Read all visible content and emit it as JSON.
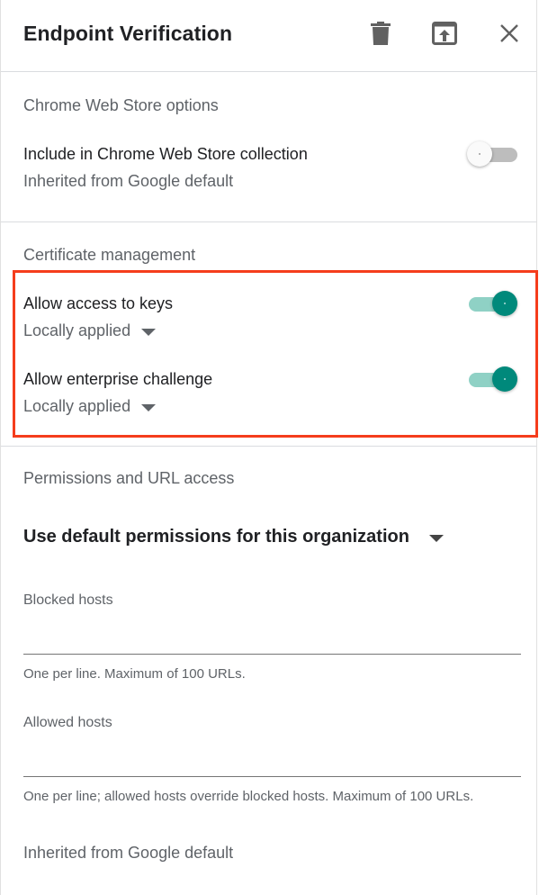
{
  "header": {
    "title": "Endpoint Verification",
    "icons": [
      "delete-icon",
      "open-in-new-icon",
      "close-icon"
    ]
  },
  "chrome_web_store": {
    "section_title": "Chrome Web Store options",
    "include_label": "Include in Chrome Web Store collection",
    "include_sub": "Inherited from Google default",
    "include_enabled": false
  },
  "certificate": {
    "section_title": "Certificate management",
    "allow_keys_label": "Allow access to keys",
    "allow_keys_sub": "Locally applied",
    "allow_keys_enabled": true,
    "allow_challenge_label": "Allow enterprise challenge",
    "allow_challenge_sub": "Locally applied",
    "allow_challenge_enabled": true
  },
  "permissions": {
    "section_title": "Permissions and URL access",
    "selected": "Use default permissions for this organization",
    "blocked_label": "Blocked hosts",
    "blocked_value": "",
    "blocked_helper": "One per line. Maximum of 100 URLs.",
    "allowed_label": "Allowed hosts",
    "allowed_value": "",
    "allowed_helper": "One per line; allowed hosts override blocked hosts. Maximum of 100 URLs.",
    "footer": "Inherited from Google default"
  },
  "colors": {
    "accent": "#00897b",
    "accent_track": "#8fd1c5",
    "highlight": "#f53d1c"
  }
}
